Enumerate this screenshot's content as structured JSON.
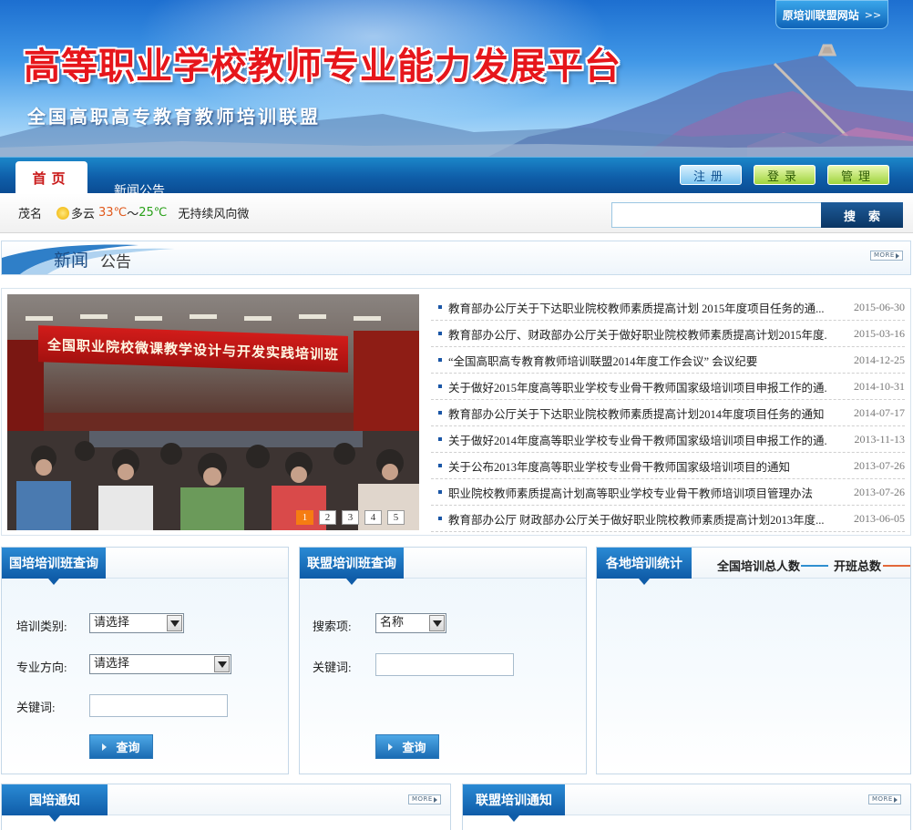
{
  "banner": {
    "title": "高等职业学校教师专业能力发展平台",
    "subtitle": "全国高职高专教育教师培训联盟",
    "original_site": "原培训联盟网站",
    "original_site_arrow": ">>"
  },
  "nav": {
    "home": "首页",
    "news": "新闻公告",
    "register": "注册",
    "login": "登录",
    "admin": "管理"
  },
  "weather": {
    "city": "茂名",
    "condition": "多云",
    "high": "33℃",
    "separator": "～",
    "low": "25℃",
    "wind": "无持续风向微"
  },
  "search": {
    "button": "搜索",
    "value": ""
  },
  "news": {
    "title_bold": "新闻",
    "title_rest": "公告",
    "more": "MORE",
    "photo_caption": "全国职业院校微课教学设计与开发实践培训班",
    "pages": [
      "1",
      "2",
      "3",
      "4",
      "5"
    ],
    "items": [
      {
        "title": "教育部办公厅关于下达职业院校教师素质提高计划 2015年度项目任务的通...",
        "date": "2015-06-30"
      },
      {
        "title": "教育部办公厅、财政部办公厅关于做好职业院校教师素质提高计划2015年度...",
        "date": "2015-03-16"
      },
      {
        "title": "“全国高职高专教育教师培训联盟2014年度工作会议” 会议纪要",
        "date": "2014-12-25"
      },
      {
        "title": "关于做好2015年度高等职业学校专业骨干教师国家级培训项目申报工作的通...",
        "date": "2014-10-31"
      },
      {
        "title": "教育部办公厅关于下达职业院校教师素质提高计划2014年度项目任务的通知",
        "date": "2014-07-17"
      },
      {
        "title": "关于做好2014年度高等职业学校专业骨干教师国家级培训项目申报工作的通...",
        "date": "2013-11-13"
      },
      {
        "title": "关于公布2013年度高等职业学校专业骨干教师国家级培训项目的通知",
        "date": "2013-07-26"
      },
      {
        "title": "职业院校教师素质提高计划高等职业学校专业骨干教师培训项目管理办法",
        "date": "2013-07-26"
      },
      {
        "title": "教育部办公厅 财政部办公厅关于做好职业院校教师素质提高计划2013年度...",
        "date": "2013-06-05"
      }
    ]
  },
  "guopei_query": {
    "title": "国培培训班查询",
    "type_label": "培训类别:",
    "type_value": "请选择",
    "major_label": "专业方向:",
    "major_value": "请选择",
    "keyword_label": "关键词:",
    "button": "查询"
  },
  "lianmeng_query": {
    "title": "联盟培训班查询",
    "item_label": "搜索项:",
    "item_value": "名称",
    "keyword_label": "关键词:",
    "button": "查询"
  },
  "stats": {
    "title": "各地培训统计",
    "legend_total_people": "全国培训总人数",
    "legend_total_classes": "开班总数",
    "colors": {
      "people": "#2f8fd0",
      "classes": "#e2683a"
    }
  },
  "notices": {
    "guopei": "国培通知",
    "lianmeng": "联盟培训通知",
    "more": "MORE"
  }
}
